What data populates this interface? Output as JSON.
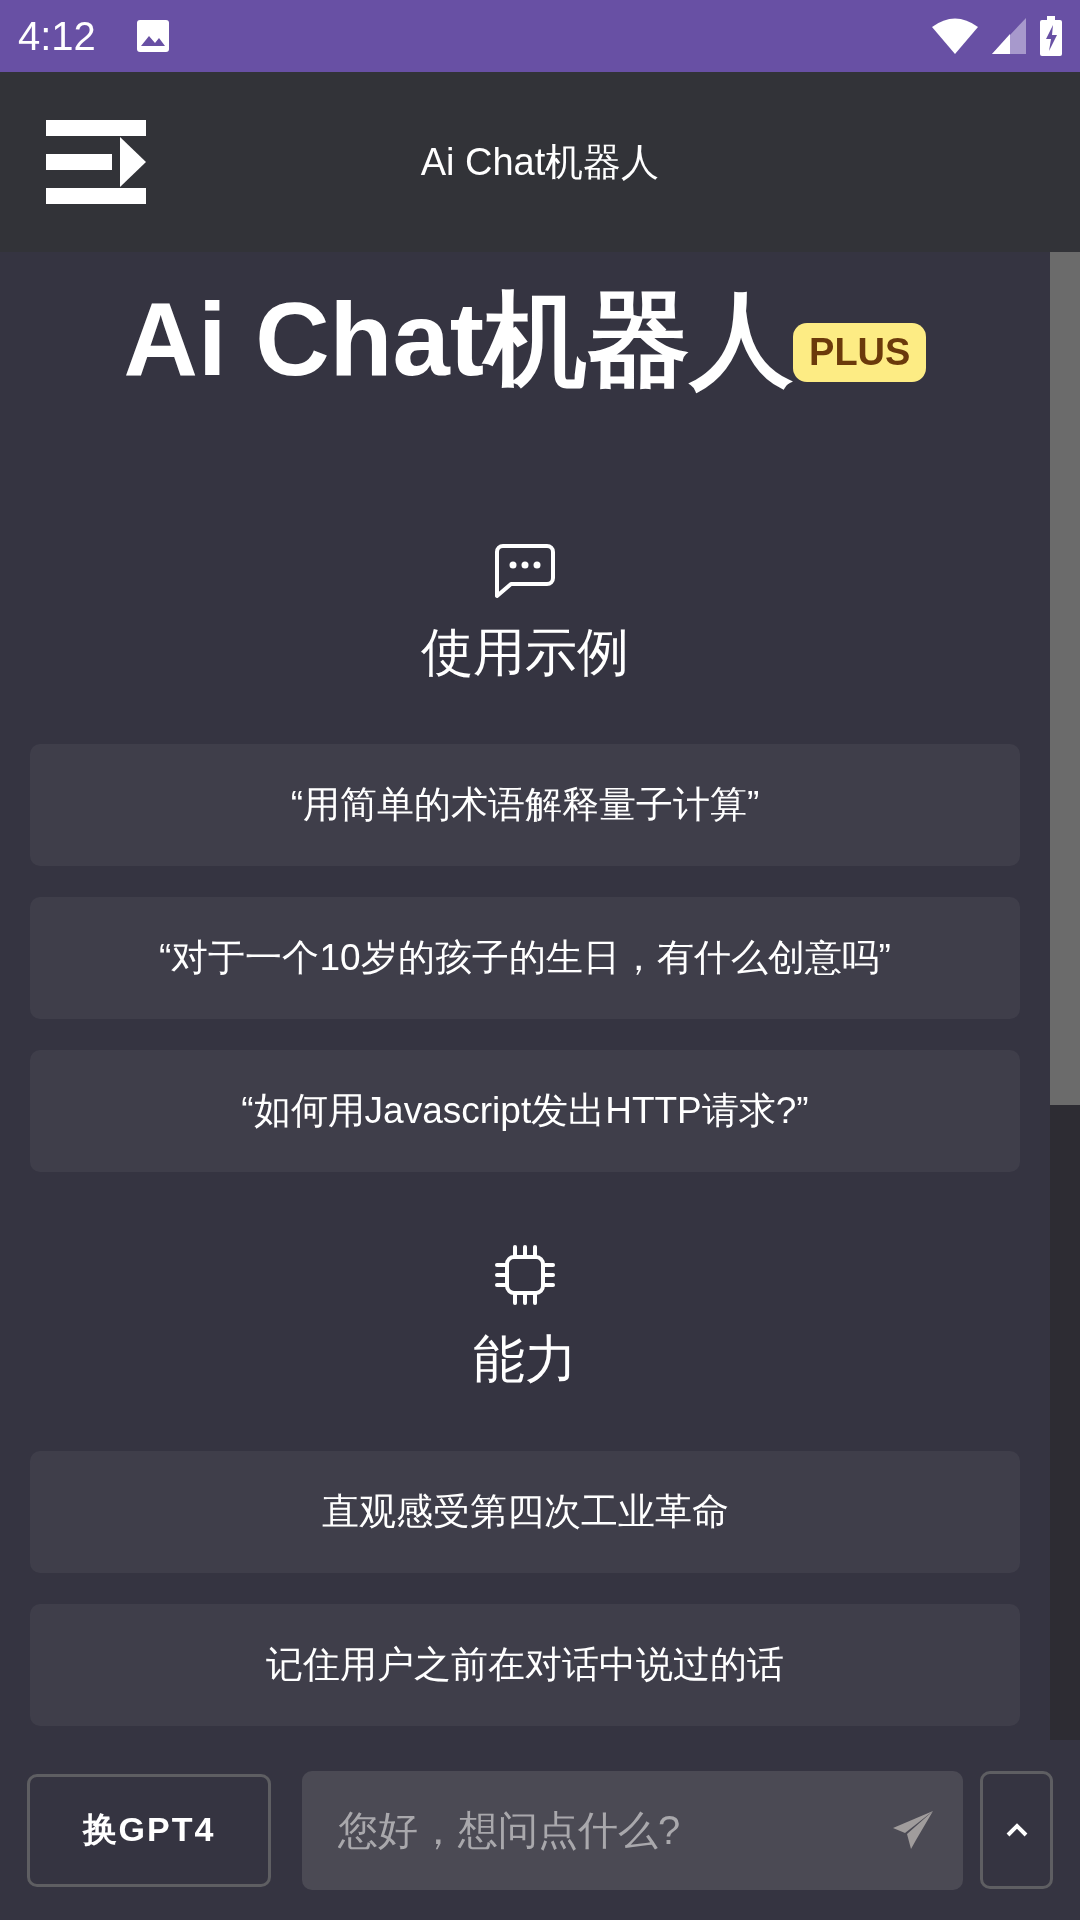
{
  "status_bar": {
    "time": "4:12"
  },
  "header": {
    "title": "Ai Chat机器人"
  },
  "hero": {
    "title": "Ai Chat机器人",
    "badge": "PLUS"
  },
  "sections": [
    {
      "heading": "使用示例",
      "cards": [
        "“用简单的术语解释量子计算”",
        "“对于一个10岁的孩子的生日，有什么创意吗”",
        "“如何用Javascript发出HTTP请求?”"
      ]
    },
    {
      "heading": "能力",
      "cards": [
        "直观感受第四次工业革命",
        "记住用户之前在对话中说过的话"
      ]
    }
  ],
  "bottom_bar": {
    "model_button": "换GPT4",
    "input": {
      "placeholder": "您好，想问点什么?"
    }
  }
}
